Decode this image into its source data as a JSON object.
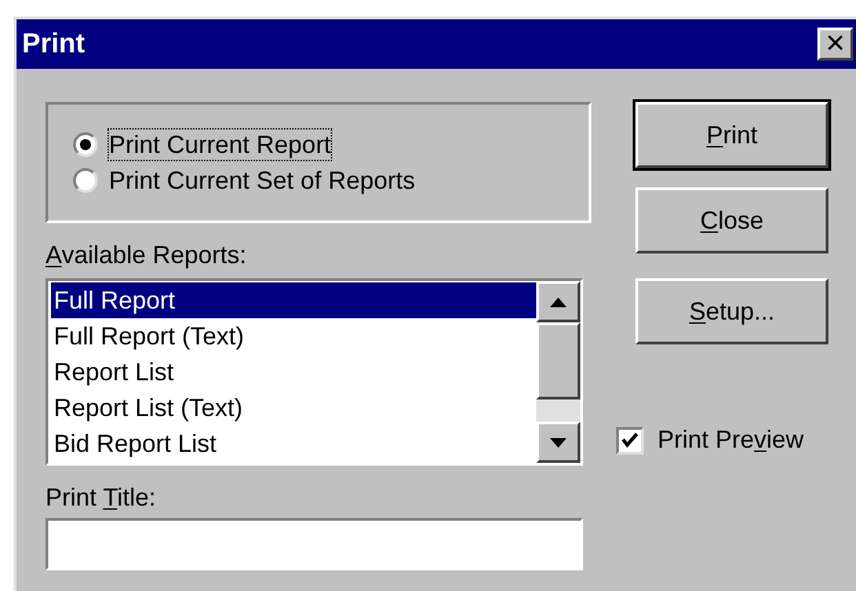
{
  "window": {
    "title": "Print",
    "close": "×"
  },
  "print_scope": [
    {
      "label": "Print Current Report",
      "selected": true
    },
    {
      "label": "Print Current Set of Reports",
      "selected": false
    }
  ],
  "available_reports": {
    "label": {
      "key": "A",
      "after": "vailable Reports:"
    },
    "items": [
      {
        "label": "Full Report",
        "selected": true
      },
      {
        "label": "Full Report (Text)",
        "selected": false
      },
      {
        "label": "Report List",
        "selected": false
      },
      {
        "label": "Report List (Text)",
        "selected": false
      },
      {
        "label": "Bid Report List",
        "selected": false
      }
    ]
  },
  "print_title": {
    "label": {
      "before": "Print ",
      "key": "T",
      "after": "itle:"
    }
  },
  "buttons": [
    {
      "label": {
        "key": "P",
        "after": "rint"
      },
      "default": true
    },
    {
      "label": {
        "key": "C",
        "after": "lose"
      },
      "default": false
    },
    {
      "label": {
        "key": "S",
        "after": "etup..."
      },
      "default": false
    }
  ],
  "print_preview": {
    "label": {
      "before": "Print Pre",
      "key": "v",
      "after": "iew"
    },
    "checked": true
  }
}
